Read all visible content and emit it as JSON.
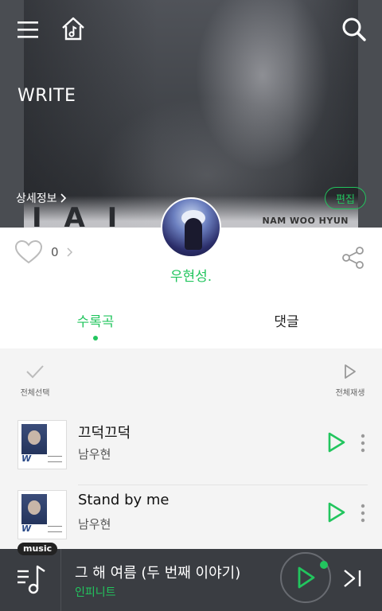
{
  "header": {
    "playlist_title": "WRITE",
    "detail_link": "상세정보",
    "edit_badge": "편집",
    "hero_artist_mark": "NAM WOO HYUN"
  },
  "owner": {
    "name": "우현성."
  },
  "likes": {
    "count": "0"
  },
  "tabs": [
    {
      "label": "수록곡",
      "active": true
    },
    {
      "label": "댓글",
      "active": false
    }
  ],
  "toolbar": {
    "select_all_label": "전체선택",
    "play_all_label": "전체재생"
  },
  "tracks": [
    {
      "title": "끄덕끄덕",
      "artist": "남우현",
      "cover_mark": "W"
    },
    {
      "title": "Stand by me",
      "artist": "남우현",
      "cover_mark": "W"
    }
  ],
  "player": {
    "badge": "music",
    "now_title": "그 해 여름 (두 번째 이야기)",
    "now_artist": "인피니트"
  },
  "colors": {
    "accent": "#22c55e",
    "player_bg": "#3a3d42"
  }
}
